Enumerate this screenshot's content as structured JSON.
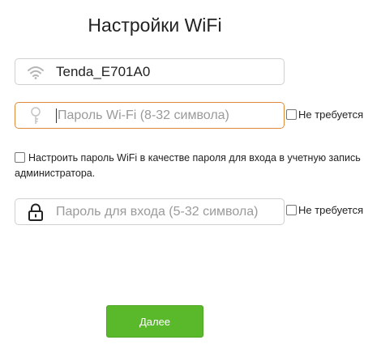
{
  "page": {
    "title": "Настройки WiFi"
  },
  "ssid": {
    "value": "Tenda_E701A0",
    "icon": "wifi-icon"
  },
  "wifi_password": {
    "placeholder": "Пароль Wi-Fi (8-32 символа)",
    "icon": "key-icon",
    "not_required_label": "Не требуется"
  },
  "sync_option": {
    "label": "Настроить пароль WiFi в качестве пароля для входа в учетную запись администратора."
  },
  "login_password": {
    "placeholder": "Пароль для входа (5-32 символа)",
    "icon": "lock-icon",
    "not_required_label": "Не требуется"
  },
  "actions": {
    "next_label": "Далее"
  },
  "colors": {
    "accent_green": "#5ab82b",
    "focus_orange": "#e08a3c"
  }
}
